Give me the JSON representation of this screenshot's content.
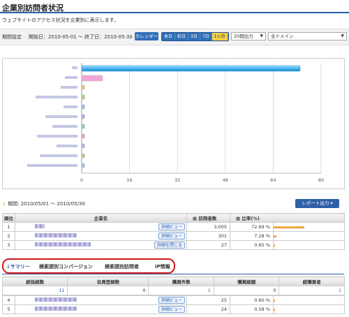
{
  "page": {
    "title": "企業別訪問者状況",
    "subtitle": "ウェブサイトのアクセス状況を企業別に表示します。"
  },
  "filters": {
    "period_label": "期間設定",
    "start_label": "開始日：",
    "start_value": "2010-05-01",
    "range_sep": "～",
    "end_label": "終了日：",
    "end_value": "2010-05-30",
    "calendar_button": "カレンダー",
    "range_buttons": [
      "本日",
      "前日",
      "3日",
      "7日",
      "1ヶ月"
    ],
    "range_selected_index": 4,
    "output_count": "20個出力",
    "domain_select": "全ドメイン"
  },
  "chart_data": {
    "type": "bar",
    "orientation": "horizontal",
    "series": [
      {
        "values": [
          73,
          7,
          1,
          1,
          1,
          1,
          1,
          1,
          1,
          1,
          1
        ]
      }
    ],
    "x_ticks": [
      "0",
      "16",
      "32",
      "48",
      "64",
      "80"
    ],
    "xlim": [
      0,
      80
    ],
    "grid": true
  },
  "report": {
    "period_text": "期間: 2010/05/01 ～ 2010/05/30",
    "output_button": "レポート出力"
  },
  "table": {
    "headers": {
      "rank": "順位",
      "company": "企業名",
      "visits": "訪問者数",
      "ratio": "比率(%)"
    },
    "detail_view": "詳細ビュー",
    "detail_close": "詳細を閉じる",
    "rows": [
      {
        "rank": "1",
        "visits": "3,005",
        "ratio": "72.69 %",
        "share": 72.69
      },
      {
        "rank": "2",
        "visits": "301",
        "ratio": "7.28 %",
        "share": 7.28
      },
      {
        "rank": "3",
        "visits": "27",
        "ratio": "0.65 %",
        "share": 0.65
      }
    ],
    "rows_after": [
      {
        "rank": "4",
        "visits": "25",
        "ratio": "0.60 %",
        "share": 0.6
      },
      {
        "rank": "5",
        "visits": "24",
        "ratio": "0.58 %",
        "share": 0.58
      }
    ]
  },
  "detail_tabs": [
    "サマリー",
    "検索語別コンバージョン",
    "検索語別訪問者",
    "IP情報"
  ],
  "summary": {
    "headers": [
      "統括総数",
      "会員登録数",
      "購買件数",
      "購買総額",
      "統購買者"
    ],
    "values": [
      "11",
      "0",
      "1",
      "0",
      "1"
    ]
  }
}
